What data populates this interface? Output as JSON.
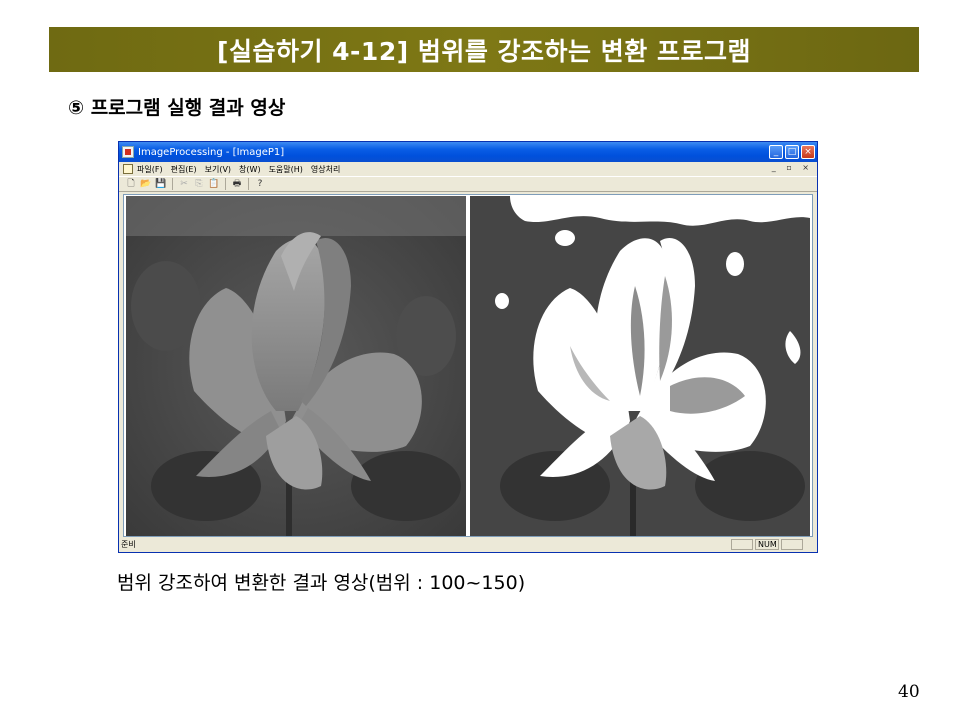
{
  "slide": {
    "title": "[실습하기 4-12] 범위를 강조하는 변환 프로그램",
    "subtitle": "⑤ 프로그램 실행 결과 영상",
    "caption": "범위 강조하여 변환한 결과 영상(범위 : 100~150)",
    "page_number": "40"
  },
  "window": {
    "title": "ImageProcessing - [ImageP1]",
    "controls": {
      "minimize": "_",
      "maximize": "□",
      "close": "×"
    },
    "mdi_controls": "_ ▫ ×"
  },
  "menu": {
    "items": [
      "파일(F)",
      "편집(E)",
      "보기(V)",
      "창(W)",
      "도움말(H)",
      "영상처리"
    ]
  },
  "toolbar": {
    "new_icon": "🗋",
    "open_icon": "📂",
    "save_icon": "💾",
    "cut_icon": "✂",
    "copy_icon": "⎘",
    "paste_icon": "📋",
    "print_icon": "🖶",
    "help_icon": "?"
  },
  "statusbar": {
    "text": "준비",
    "num": "NUM"
  },
  "colors": {
    "title_bar": "#7a7414",
    "window_title": "#0a5ee6",
    "window_frame": "#ece9d8"
  }
}
